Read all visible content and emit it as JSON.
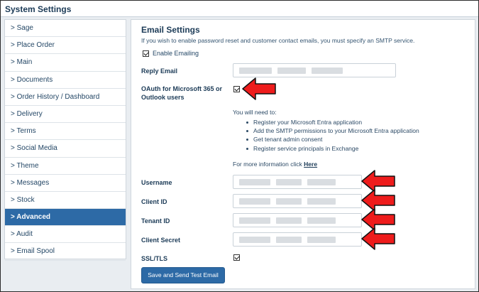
{
  "window": {
    "title": "System Settings"
  },
  "sidebar": {
    "items": [
      {
        "label": "> Sage",
        "active": false
      },
      {
        "label": "> Place Order",
        "active": false
      },
      {
        "label": "> Main",
        "active": false
      },
      {
        "label": "> Documents",
        "active": false
      },
      {
        "label": "> Order History / Dashboard",
        "active": false
      },
      {
        "label": "> Delivery",
        "active": false
      },
      {
        "label": "> Terms",
        "active": false
      },
      {
        "label": "> Social Media",
        "active": false
      },
      {
        "label": "> Theme",
        "active": false
      },
      {
        "label": "> Messages",
        "active": false
      },
      {
        "label": "> Stock",
        "active": false
      },
      {
        "label": "> Advanced",
        "active": true
      },
      {
        "label": "> Audit",
        "active": false
      },
      {
        "label": "> Email Spool",
        "active": false
      }
    ]
  },
  "email": {
    "heading": "Email Settings",
    "description": "If you wish to enable password reset and customer contact emails, you must specify an SMTP service.",
    "enable_label": "Enable Emailing",
    "enable_checked": true,
    "reply_label": "Reply Email",
    "oauth_label": "OAuth for Microsoft 365 or Outlook users",
    "oauth_checked": true,
    "need_text": "You will need to:",
    "steps": [
      "Register your Microsoft Entra application",
      "Add the SMTP permissions to your Microsoft Entra application",
      "Get tenant admin consent",
      "Register service principals in Exchange"
    ],
    "more_text": "For more information click",
    "more_link": "Here",
    "username_label": "Username",
    "client_id_label": "Client ID",
    "tenant_id_label": "Tenant ID",
    "client_secret_label": "Client Secret",
    "ssl_label": "SSL/TLS",
    "ssl_checked": true,
    "submit_label": "Save and Send Test Email"
  },
  "colors": {
    "accent": "#2d6aa6",
    "arrow": "#ee1c1c"
  }
}
